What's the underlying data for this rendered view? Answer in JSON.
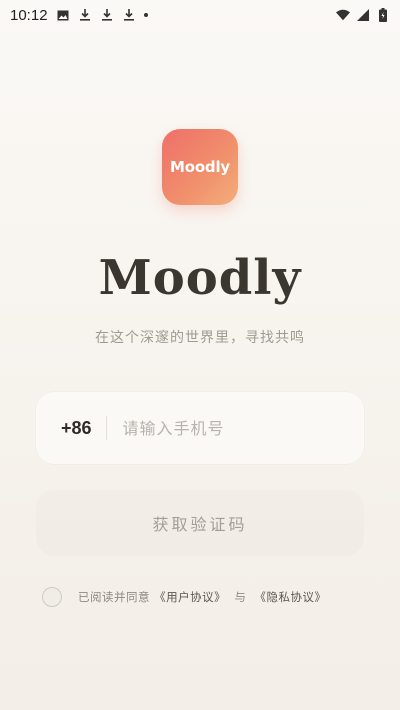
{
  "status_bar": {
    "time": "10:12",
    "left_icons": [
      "image-icon",
      "download-icon",
      "download-icon",
      "download-icon",
      "dot-icon"
    ],
    "right_icons": [
      "wifi-icon",
      "signal-icon",
      "battery-icon"
    ]
  },
  "app": {
    "icon_text": "Moodly",
    "title": "Moodly",
    "tagline": "在这个深邃的世界里，寻找共鸣"
  },
  "login": {
    "country_code": "+86",
    "phone_placeholder": "请输入手机号",
    "get_code_label": "获取验证码"
  },
  "agreement": {
    "prefix": "已阅读并同意",
    "user_agreement": "《用户协议》",
    "and": "与",
    "privacy_policy": "《隐私协议》"
  },
  "colors": {
    "accent_gradient_start": "#ef6f6a",
    "accent_gradient_end": "#f4ad7a",
    "title": "#3b362f",
    "muted": "#9f9a93"
  }
}
